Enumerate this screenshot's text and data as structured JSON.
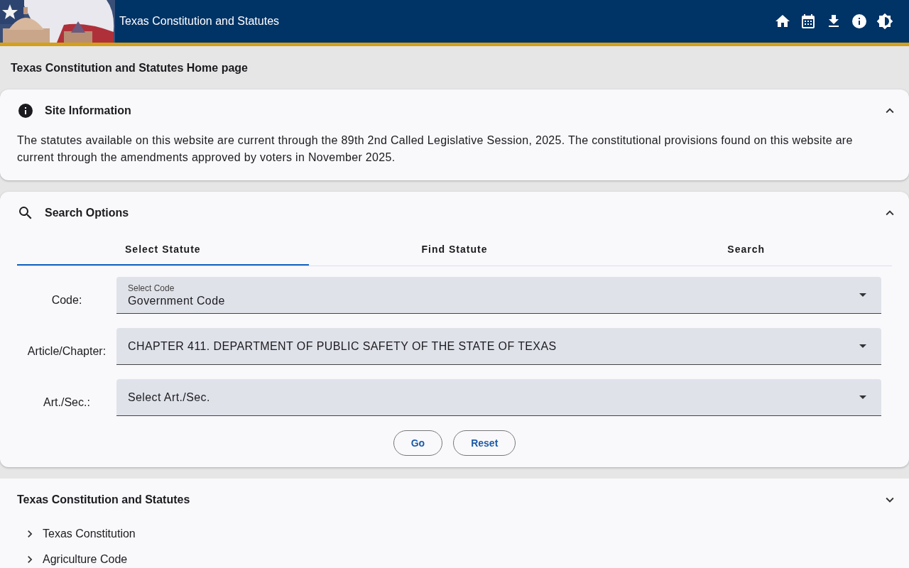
{
  "header": {
    "title": "Texas Constitution and Statutes",
    "actions": [
      {
        "kind": "home"
      },
      {
        "kind": "calendar"
      },
      {
        "kind": "download"
      },
      {
        "kind": "info"
      },
      {
        "kind": "theme"
      }
    ]
  },
  "page_title": "Texas Constitution and Statutes Home page",
  "site_info": {
    "title": "Site Information",
    "expanded": true,
    "text": "The statutes available on this website are current through the 89th 2nd Called Legislative Session, 2025. The constitutional provisions found on this website are current through the amendments approved by voters in November 2025."
  },
  "search_options": {
    "title": "Search Options",
    "expanded": true,
    "tabs": [
      {
        "label": "Select Statute",
        "selected": true
      },
      {
        "label": "Find Statute",
        "selected": false
      },
      {
        "label": "Search",
        "selected": false
      }
    ],
    "fields": [
      {
        "label": "Code:",
        "floating_label": "Select Code",
        "value": "Government Code"
      },
      {
        "label": "Article/Chapter:",
        "value": "CHAPTER 411. DEPARTMENT OF PUBLIC SAFETY OF THE STATE OF TEXAS"
      },
      {
        "label": "Art./Sec.:",
        "placeholder": "Select Art./Sec."
      }
    ],
    "buttons": [
      "Go",
      "Reset"
    ]
  },
  "tree": {
    "title": "Texas Constitution and Statutes",
    "items": [
      {
        "label": "Texas Constitution",
        "expanded": false
      },
      {
        "label": "Agriculture Code",
        "expanded": false
      }
    ]
  }
}
